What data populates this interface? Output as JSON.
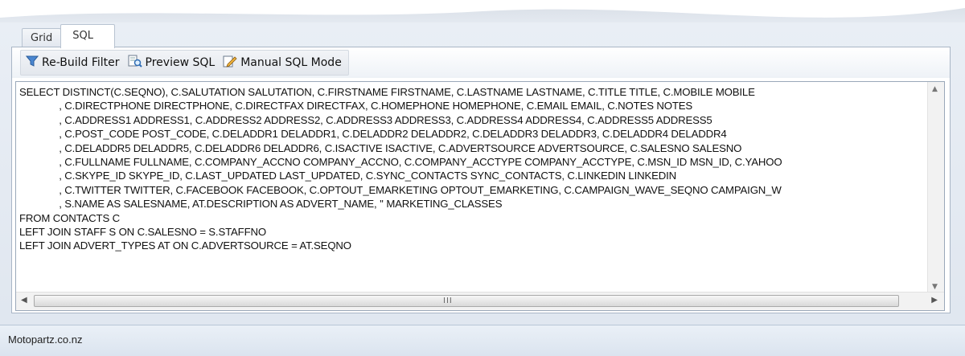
{
  "tabs": [
    {
      "label": "Grid",
      "active": false
    },
    {
      "label": "SQL",
      "active": true
    }
  ],
  "toolbar": {
    "rebuild_label": "Re-Build Filter",
    "preview_label": "Preview SQL",
    "manual_label": "Manual SQL Mode",
    "rebuild_icon": "filter-icon",
    "preview_icon": "preview-sql-icon",
    "manual_icon": "pencil-edit-icon"
  },
  "sql": {
    "lines": [
      "SELECT DISTINCT(C.SEQNO), C.SALUTATION SALUTATION, C.FIRSTNAME FIRSTNAME, C.LASTNAME LASTNAME, C.TITLE TITLE, C.MOBILE MOBILE",
      "              , C.DIRECTPHONE DIRECTPHONE, C.DIRECTFAX DIRECTFAX, C.HOMEPHONE HOMEPHONE, C.EMAIL EMAIL, C.NOTES NOTES",
      "              , C.ADDRESS1 ADDRESS1, C.ADDRESS2 ADDRESS2, C.ADDRESS3 ADDRESS3, C.ADDRESS4 ADDRESS4, C.ADDRESS5 ADDRESS5",
      "              , C.POST_CODE POST_CODE, C.DELADDR1 DELADDR1, C.DELADDR2 DELADDR2, C.DELADDR3 DELADDR3, C.DELADDR4 DELADDR4",
      "              , C.DELADDR5 DELADDR5, C.DELADDR6 DELADDR6, C.ISACTIVE ISACTIVE, C.ADVERTSOURCE ADVERTSOURCE, C.SALESNO SALESNO",
      "              , C.FULLNAME FULLNAME, C.COMPANY_ACCNO COMPANY_ACCNO, C.COMPANY_ACCTYPE COMPANY_ACCTYPE, C.MSN_ID MSN_ID, C.YAHOO",
      "              , C.SKYPE_ID SKYPE_ID, C.LAST_UPDATED LAST_UPDATED, C.SYNC_CONTACTS SYNC_CONTACTS, C.LINKEDIN LINKEDIN",
      "              , C.TWITTER TWITTER, C.FACEBOOK FACEBOOK, C.OPTOUT_EMARKETING OPTOUT_EMARKETING, C.CAMPAIGN_WAVE_SEQNO CAMPAIGN_W",
      "              , S.NAME AS SALESNAME, AT.DESCRIPTION AS ADVERT_NAME, '' MARKETING_CLASSES",
      "FROM CONTACTS C",
      "LEFT JOIN STAFF S ON C.SALESNO = S.STAFFNO",
      "LEFT JOIN ADVERT_TYPES AT ON C.ADVERTSOURCE = AT.SEQNO"
    ]
  },
  "scrollbar": {
    "grip": "III"
  },
  "status": {
    "text": "Motopartz.co.nz"
  },
  "colors": {
    "accent": "#4a7fbf",
    "frame": "#e4eaf2"
  }
}
